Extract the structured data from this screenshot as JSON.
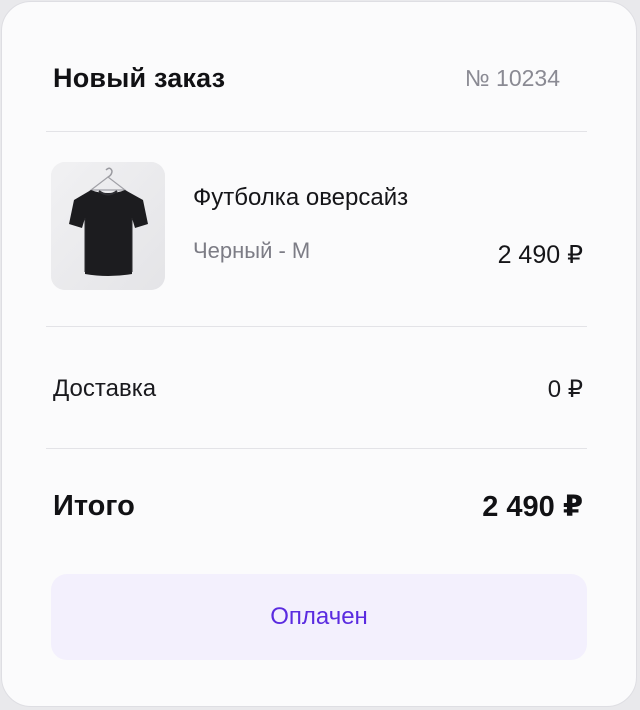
{
  "order": {
    "title": "Новый заказ",
    "number": "№ 10234"
  },
  "item": {
    "name": "Футболка оверсайз",
    "variant": "Черный - M",
    "price": "2 490 ₽",
    "image_icon": "tshirt-icon"
  },
  "delivery": {
    "label": "Доставка",
    "value": "0 ₽"
  },
  "total": {
    "label": "Итого",
    "value": "2 490 ₽"
  },
  "status": {
    "label": "Оплачен",
    "color": "#5a2be0",
    "background": "#f3f0fd"
  }
}
